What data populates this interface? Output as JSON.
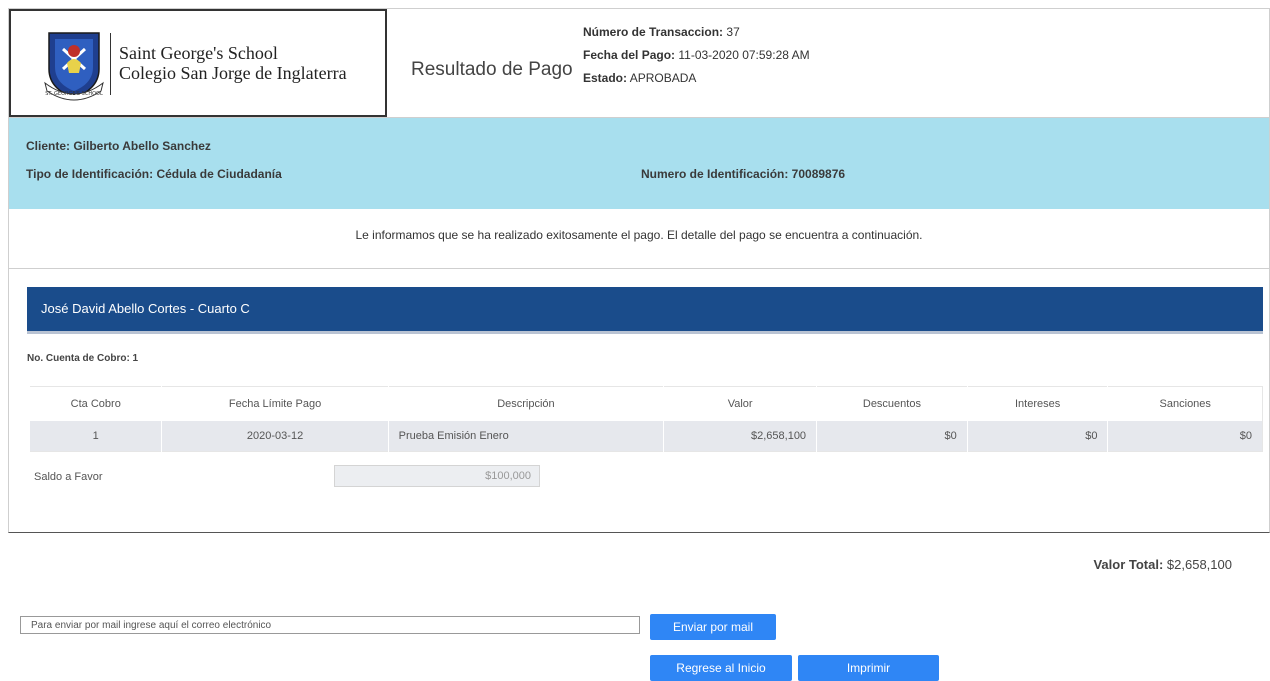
{
  "school": {
    "name_line1": "Saint George's School",
    "name_line2": "Colegio San Jorge de Inglaterra",
    "crest_ribbon": "ST. GEORGE'S SCHOOL"
  },
  "header": {
    "result_title": "Resultado de Pago",
    "transaction_label": "Número de Transaccion:",
    "transaction_value": "37",
    "date_label": "Fecha del Pago:",
    "date_value": "11-03-2020 07:59:28 AM",
    "status_label": "Estado:",
    "status_value": "APROBADA"
  },
  "client": {
    "name_line": "Cliente: Gilberto Abello Sanchez",
    "id_type_line": "Tipo de Identificación: Cédula de Ciudadanía",
    "id_number_line": "Numero de Identificación: 70089876"
  },
  "notice": "Le informamos que se ha realizado exitosamente el pago. El detalle del pago se encuentra a continuación.",
  "student": {
    "title": "José David Abello Cortes - Cuarto C",
    "cuenta_label": "No. Cuenta de Cobro: 1"
  },
  "table": {
    "headers": [
      "Cta Cobro",
      "Fecha Límite Pago",
      "Descripción",
      "Valor",
      "Descuentos",
      "Intereses",
      "Sanciones"
    ],
    "rows": [
      [
        "1",
        "2020-03-12",
        "Prueba Emisión Enero",
        "$2,658,100",
        "$0",
        "$0",
        "$0"
      ]
    ]
  },
  "saldo": {
    "label": "Saldo a Favor",
    "value": "$100,000"
  },
  "total": {
    "label": "Valor Total:",
    "value": "$2,658,100"
  },
  "email": {
    "placeholder": "Para enviar por mail ingrese aquí el correo electrónico",
    "value": ""
  },
  "buttons": {
    "send_mail": "Enviar por mail",
    "back_home": "Regrese al Inicio",
    "print": "Imprimir"
  },
  "colors": {
    "client_band": "#a8dfee",
    "student_bar": "#1a4c8b",
    "button": "#2f86f5"
  }
}
